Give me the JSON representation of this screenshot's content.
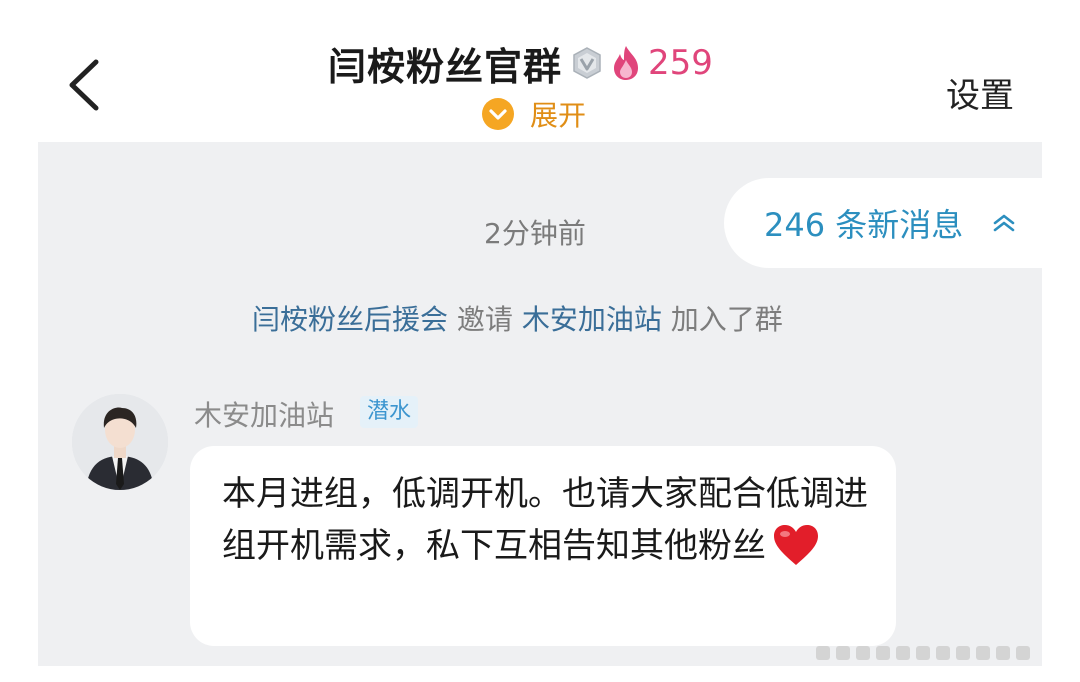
{
  "header": {
    "back_icon": "chevron-left-icon",
    "title": "闫桉粉丝官群",
    "level_icon": "shield-badge-icon",
    "fire_icon": "flame-icon",
    "member_count": "259",
    "expand_icon": "chevron-down-circle-icon",
    "expand_label": "展开",
    "settings_label": "设置"
  },
  "chat": {
    "new_messages_label": "246 条新消息",
    "new_messages_icon": "double-chevron-up-icon",
    "timestamp": "2分钟前",
    "system_notice": {
      "actor": "闫桉粉丝后援会",
      "action": "邀请",
      "target": "木安加油站",
      "suffix": "加入了群"
    },
    "message": {
      "sender": "木安加油站",
      "badge": "潜水",
      "text": "本月进组，低调开机。也请大家配合低调进组开机需求，私下互相告知其他粉丝",
      "emoji_icon": "red-heart-icon"
    }
  },
  "colors": {
    "accent_orange": "#f5a623",
    "count_pink": "#e0457b",
    "link_blue": "#3a6e98",
    "new_msg_blue": "#2c8fbf",
    "chat_bg": "#eff0f2"
  }
}
